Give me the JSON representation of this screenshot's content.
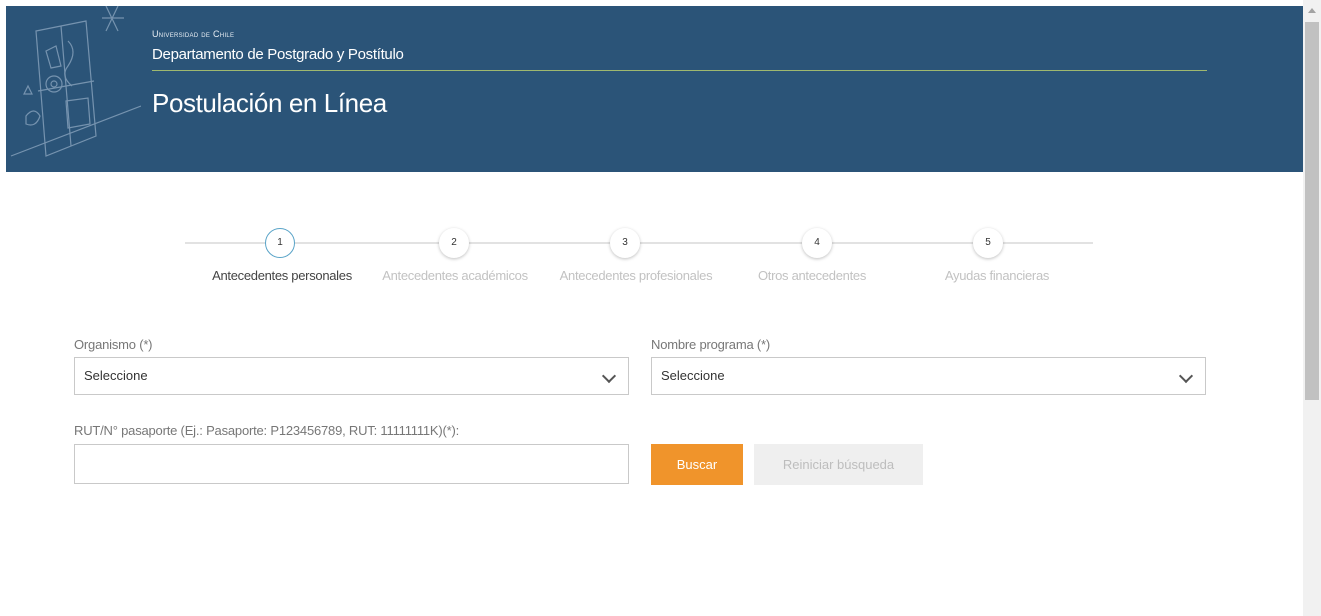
{
  "header": {
    "university": "Universidad de Chile",
    "department": "Departamento de Postgrado y Postítulo",
    "title": "Postulación en Línea"
  },
  "colors": {
    "header_bg": "#2b5478",
    "accent_line": "#9fb86f",
    "primary_button": "#f0942b",
    "active_step_border": "#5aa4c8"
  },
  "stepper": {
    "active_index": 0,
    "steps": [
      {
        "number": "1",
        "label": "Antecedentes personales"
      },
      {
        "number": "2",
        "label": "Antecedentes académicos"
      },
      {
        "number": "3",
        "label": "Antecedentes profesionales"
      },
      {
        "number": "4",
        "label": "Otros antecedentes"
      },
      {
        "number": "5",
        "label": "Ayudas financieras"
      }
    ]
  },
  "form": {
    "organismo": {
      "label": "Organismo (*)",
      "value": "Seleccione"
    },
    "programa": {
      "label": "Nombre programa (*)",
      "value": "Seleccione"
    },
    "rut": {
      "label": "RUT/N° pasaporte (Ej.: Pasaporte: P123456789, RUT: 11111111K)(*):",
      "value": ""
    },
    "search_button": "Buscar",
    "reset_button": "Reiniciar búsqueda"
  },
  "icons": {
    "crest": "university-crest-icon",
    "select_arrow": "chevron-down-icon",
    "scroll_up": "scroll-up-arrow-icon"
  }
}
